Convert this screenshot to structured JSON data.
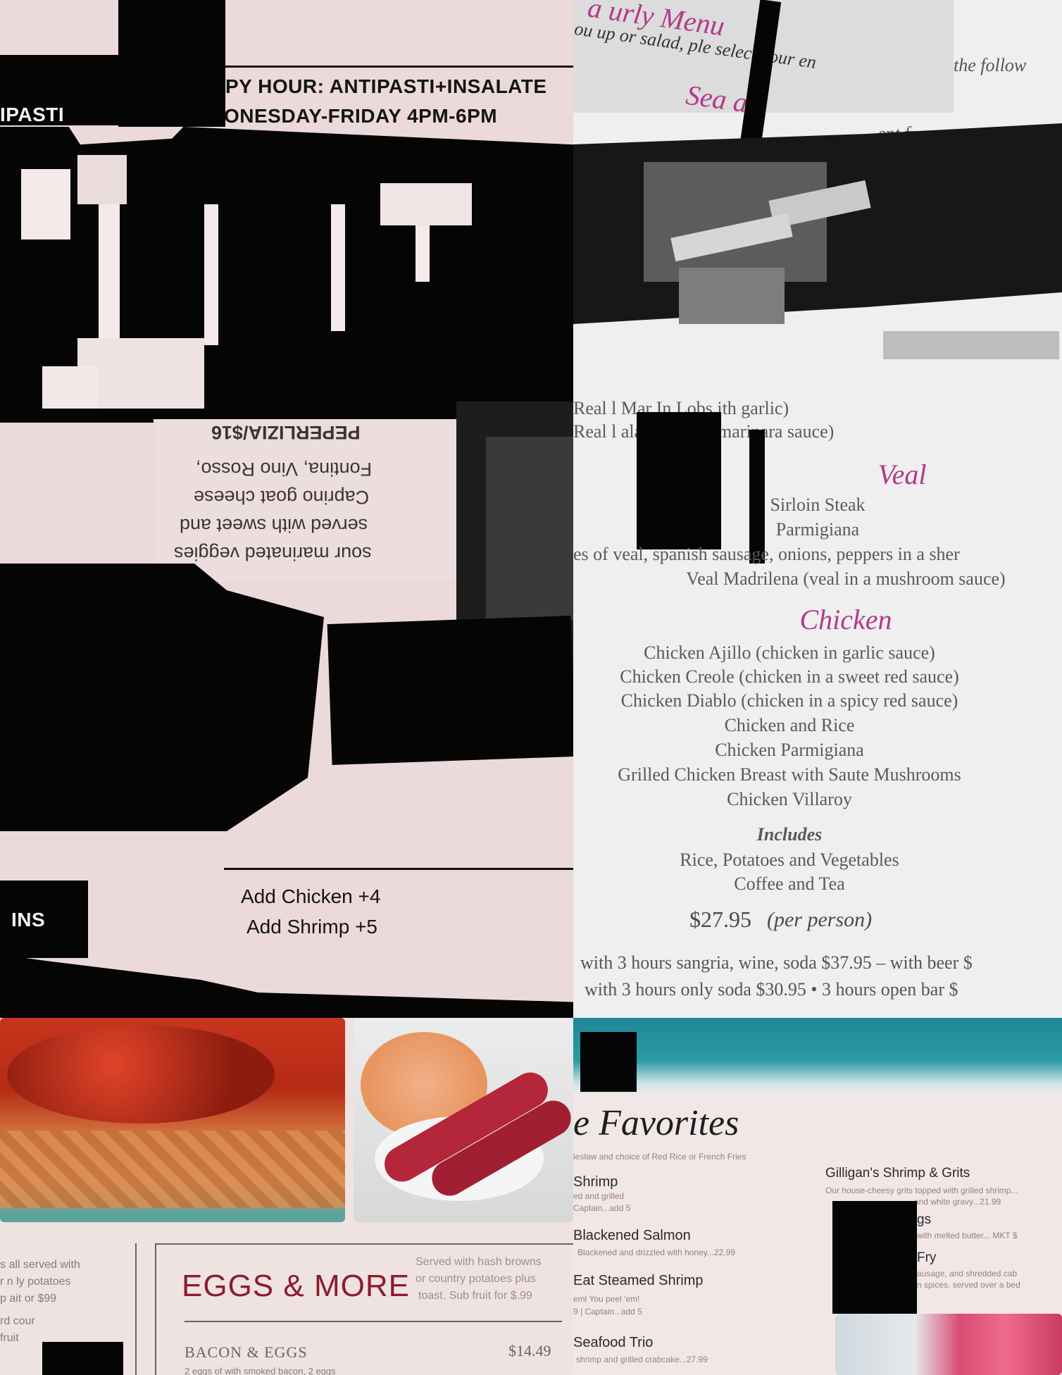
{
  "top_left": {
    "tab_partial": "IPASTI",
    "happy_hour_title": "PY HOUR: ANTIPASTI+INSALATE",
    "happy_hour_days": "ONESDAY-FRIDAY 4PM-6PM",
    "mirrored_item": {
      "name": "PEPERLIZIA/$16",
      "lines": [
        "Fontina, Vino Rosso,",
        "Caprino goat cheese",
        "served with sweet and",
        "sour marinated veggies"
      ]
    },
    "side_label_partial": "INS",
    "add_ons": [
      "Add Chicken +4",
      "Add Shrimp +5"
    ]
  },
  "top_right": {
    "frag_1": "ou up or salad, ple  select your en",
    "frag_2": "the follow",
    "header_partial": "a urly Menu",
    "seafood_partial": "Sea  ad",
    "frag_3": "ent fr",
    "seafood_lines": [
      "Real l  Mar  In Lobs   ith garlic)",
      "Real l      alamari with marinara sauce)"
    ],
    "veal_heading": "Veal",
    "veal_lines": [
      "Sirloin Steak",
      "Parmigiana",
      "es of veal, spanish sausage, onions, peppers in a sher",
      "Veal Madrilena (veal in a mushroom sauce)"
    ],
    "chicken_heading": "Chicken",
    "chicken_lines": [
      "Chicken Ajillo (chicken in garlic sauce)",
      "Chicken Creole (chicken in a sweet red sauce)",
      "Chicken Diablo (chicken in a spicy red sauce)",
      "Chicken and Rice",
      "Chicken Parmigiana",
      "Grilled Chicken Breast with Saute Mushrooms",
      "Chicken Villaroy"
    ],
    "includes_heading": "Includes",
    "includes_lines": [
      "Rice, Potatoes and Vegetables",
      "Coffee and Tea"
    ],
    "price_main": "$27.95",
    "price_note": "(per person)",
    "footer_1": "with 3 hours sangria, wine, soda $37.95 – with beer $",
    "footer_2": "with 3 hours only soda $30.95  •  3 hours open bar $"
  },
  "bottom_left": {
    "side_text": [
      "s all served with",
      "r n  ly potatoes",
      "p ait or $99",
      "rd  cour",
      "fruit"
    ],
    "section_title": "EGGS & MORE",
    "section_note": [
      "Served with hash browns",
      "or country potatoes plus",
      "toast. Sub fruit for $.99"
    ],
    "item_name": "BACON & EGGS",
    "item_price": "$14.49",
    "item_desc": "2 eggs  of  with  smoked bacon, 2 eggs"
  },
  "bottom_right": {
    "title_partial": "e Favorites",
    "subtitle": "leslaw and choice of Red Rice or French Fries",
    "left_items": [
      {
        "name": "Shrimp",
        "desc": [
          "ed and grilled",
          " Captain...add 5"
        ]
      },
      {
        "name": "Blackened Salmon",
        "desc": [
          "Blackened and drizzled with honey...22.99"
        ]
      },
      {
        "name": "Eat Steamed Shrimp",
        "desc": [
          "eml You peel 'em!",
          "9 | Captain...add 5"
        ]
      },
      {
        "name": "Seafood Trio",
        "desc": [
          "shrimp and grilled crabcake...27.99"
        ]
      }
    ],
    "right_items": [
      {
        "name": "Gilligan's Shrimp & Grits",
        "desc": [
          "Our house-cheesy grits topped with grilled shrimp...",
          "and white gravy...21.99"
        ]
      },
      {
        "name": "gs",
        "desc": [
          "with melted butter... MKT $"
        ]
      },
      {
        "name": "Fry",
        "desc": [
          "ausage, and shredded cab",
          "n spices, served over a bed"
        ]
      }
    ]
  },
  "colors": {
    "pink_bg": "#ecd9d9",
    "magenta_heading": "#b23a87",
    "eggs_title": "#8b1c2e",
    "teal": "#2a8a96"
  }
}
